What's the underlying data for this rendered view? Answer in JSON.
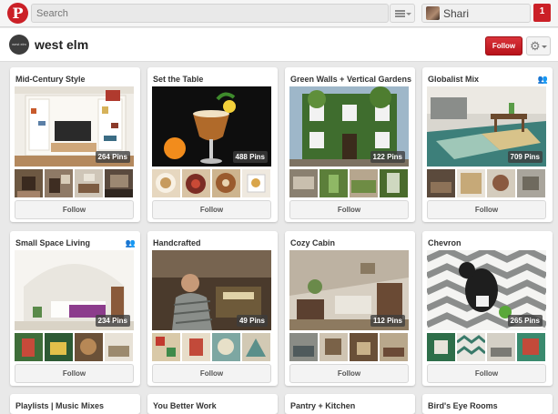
{
  "header": {
    "logo": "P",
    "search_placeholder": "Search",
    "user_name": "Shari",
    "notification_count": "1"
  },
  "profile": {
    "logo_text": "west elm",
    "name": "west elm",
    "follow_label": "Follow",
    "settings_icon": "gear-icon"
  },
  "boards": [
    {
      "title": "Mid-Century Style",
      "pins": "264 Pins",
      "follow": "Follow",
      "collab": false
    },
    {
      "title": "Set the Table",
      "pins": "488 Pins",
      "follow": "Follow",
      "collab": false
    },
    {
      "title": "Green Walls + Vertical Gardens",
      "pins": "122 Pins",
      "follow": "Follow",
      "collab": false
    },
    {
      "title": "Globalist Mix",
      "pins": "709 Pins",
      "follow": "Follow",
      "collab": true
    },
    {
      "title": "Small Space Living",
      "pins": "234 Pins",
      "follow": "Follow",
      "collab": true
    },
    {
      "title": "Handcrafted",
      "pins": "49 Pins",
      "follow": "Follow",
      "collab": false
    },
    {
      "title": "Cozy Cabin",
      "pins": "112 Pins",
      "follow": "Follow",
      "collab": false
    },
    {
      "title": "Chevron",
      "pins": "265 Pins",
      "follow": "Follow",
      "collab": false
    },
    {
      "title": "Playlists | Music Mixes",
      "collab": false
    },
    {
      "title": "You Better Work",
      "collab": false
    },
    {
      "title": "Pantry + Kitchen",
      "collab": false
    },
    {
      "title": "Bird's Eye Rooms",
      "collab": false
    }
  ]
}
